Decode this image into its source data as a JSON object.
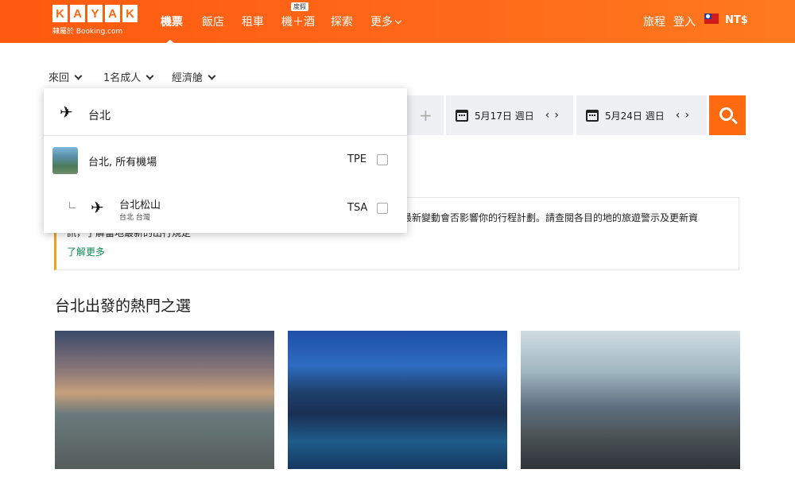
{
  "header": {
    "logo_letters": [
      "K",
      "A",
      "Y",
      "A",
      "K"
    ],
    "powered_by": "隸屬於 Booking.com",
    "nav": [
      {
        "label": "機票",
        "active": true
      },
      {
        "label": "飯店",
        "active": false
      },
      {
        "label": "租車",
        "active": false
      },
      {
        "label": "機＋酒",
        "active": false
      },
      {
        "label": "探索",
        "active": false
      },
      {
        "label": "更多",
        "active": false
      }
    ],
    "nav_badge": "度假",
    "trips": "旅程",
    "login": "登入",
    "currency": "NT$"
  },
  "search": {
    "trip_type": "來回",
    "travelers": "1名成人",
    "cabin": "經濟艙",
    "origin_value": "台北",
    "depart_date": "5月17日 週日",
    "return_date": "5月24日 週日"
  },
  "dropdown": {
    "items": [
      {
        "label": "台北, 所有機場",
        "code": "TPE"
      },
      {
        "label": "台北松山",
        "sub": "台北 台灣",
        "code": "TSA"
      }
    ]
  },
  "alert": {
    "text_line1": "最新變動會否影響你的行程計劃。請查閱各目的地的旅遊警示及更新資",
    "text_line2": "訊，了解當地最新的出行規定",
    "learn_more": "了解更多"
  },
  "popular": {
    "title": "台北出發的熱門之選"
  },
  "colors": {
    "brand": "#ff690f",
    "learn_more": "#0f8a54",
    "alert_accent": "#f0a11f"
  }
}
